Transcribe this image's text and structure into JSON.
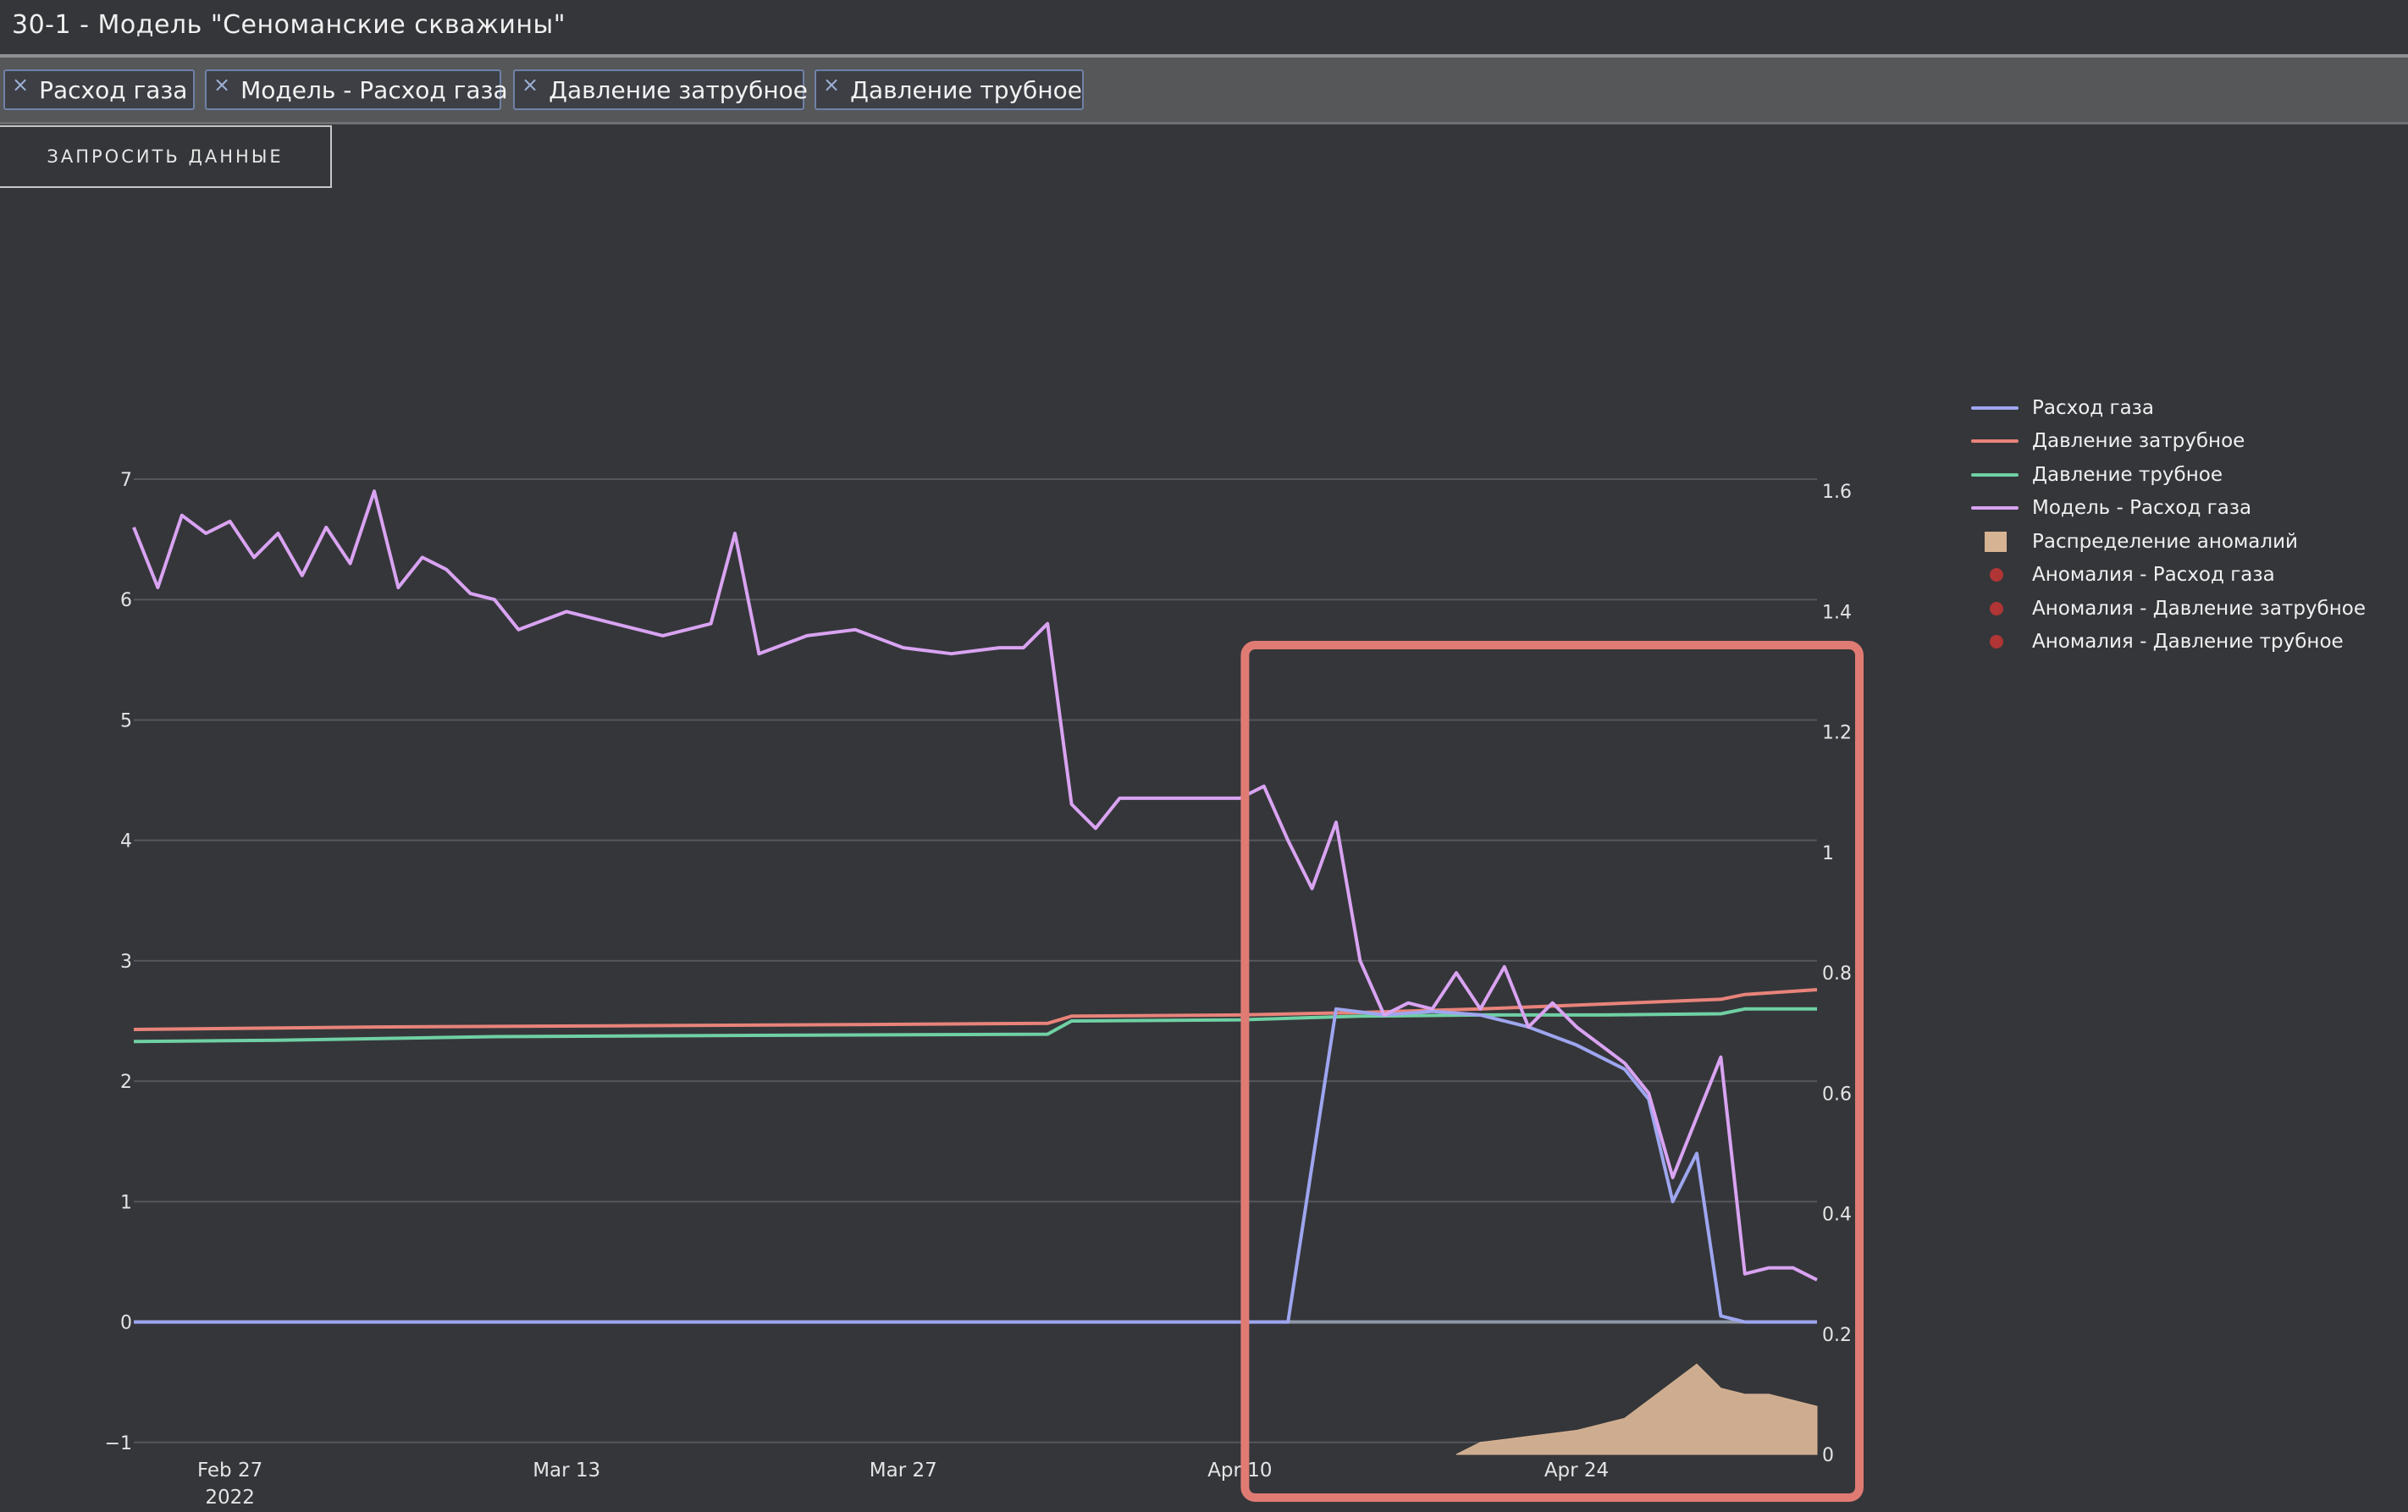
{
  "window": {
    "title": "30-1 - Модель \"Сеноманские скважины\""
  },
  "tags": [
    {
      "label": "Расход газа",
      "remove": "×"
    },
    {
      "label": "Модель - Расход газа",
      "remove": "×"
    },
    {
      "label": "Давление затрубное",
      "remove": "×"
    },
    {
      "label": "Давление трубное",
      "remove": "×"
    }
  ],
  "toolbar": {
    "request_button": "ЗАПРОСИТЬ ДАННЫЕ"
  },
  "legend": [
    {
      "label": "Расход газа",
      "color": "#9ea6f0",
      "kind": "line"
    },
    {
      "label": "Давление затрубное",
      "color": "#e8837a",
      "kind": "line"
    },
    {
      "label": "Давление трубное",
      "color": "#6fd0a4",
      "kind": "line"
    },
    {
      "label": "Модель - Расход газа",
      "color": "#d9a3f2",
      "kind": "line"
    },
    {
      "label": "Распределение аномалий",
      "color": "#d6b393",
      "kind": "box"
    },
    {
      "label": "Аномалия - Расход газа",
      "color": "#b03535",
      "kind": "dot"
    },
    {
      "label": "Аномалия - Давление затрубное",
      "color": "#b03535",
      "kind": "dot"
    },
    {
      "label": "Аномалия - Давление трубное",
      "color": "#b03535",
      "kind": "dot"
    }
  ],
  "chart_data": {
    "type": "line",
    "title": "",
    "xlabel": "",
    "ylabel": "",
    "x_range": [
      "2022-02-23",
      "2022-05-04"
    ],
    "ylim": [
      -1.1,
      7
    ],
    "y2lim": [
      0,
      1.6
    ],
    "y_ticks": [
      "7",
      "6",
      "5",
      "4",
      "3",
      "2",
      "1",
      "0",
      "−1"
    ],
    "y2_ticks": [
      "1.6",
      "1.4",
      "1.2",
      "1",
      "0.8",
      "0.6",
      "0.4",
      "0.2",
      "0"
    ],
    "x_ticks": [
      {
        "date": "2022-02-27",
        "label": "Feb 27",
        "sublabel": "2022"
      },
      {
        "date": "2022-03-13",
        "label": "Mar 13",
        "sublabel": ""
      },
      {
        "date": "2022-03-27",
        "label": "Mar 27",
        "sublabel": ""
      },
      {
        "date": "2022-04-10",
        "label": "Apr 10",
        "sublabel": ""
      },
      {
        "date": "2022-04-24",
        "label": "Apr 24",
        "sublabel": ""
      }
    ],
    "grid": true,
    "legend_position": "right",
    "highlight": {
      "x_start": "2022-04-10",
      "x_end": "2022-05-04",
      "color": "#e07b74"
    },
    "series": [
      {
        "name": "Давление затрубное",
        "axis": "left",
        "color": "#e8837a",
        "x": [
          "2022-02-23",
          "2022-03-05",
          "2022-03-15",
          "2022-03-25",
          "2022-04-02",
          "2022-04-03",
          "2022-04-10",
          "2022-04-15",
          "2022-04-20",
          "2022-04-25",
          "2022-04-30",
          "2022-05-01",
          "2022-05-04"
        ],
        "y": [
          2.43,
          2.45,
          2.46,
          2.47,
          2.48,
          2.54,
          2.55,
          2.57,
          2.6,
          2.64,
          2.68,
          2.72,
          2.76
        ]
      },
      {
        "name": "Давление трубное",
        "axis": "left",
        "color": "#6fd0a4",
        "x": [
          "2022-02-23",
          "2022-03-01",
          "2022-03-10",
          "2022-03-20",
          "2022-04-02",
          "2022-04-03",
          "2022-04-10",
          "2022-04-15",
          "2022-04-20",
          "2022-04-25",
          "2022-04-30",
          "2022-05-01",
          "2022-05-04"
        ],
        "y": [
          2.33,
          2.34,
          2.37,
          2.38,
          2.39,
          2.5,
          2.51,
          2.54,
          2.55,
          2.55,
          2.56,
          2.6,
          2.6
        ]
      },
      {
        "name": "Расход газа",
        "axis": "left",
        "color": "#9ea6f0",
        "x": [
          "2022-02-23",
          "2022-04-12",
          "2022-04-14",
          "2022-04-16",
          "2022-04-18",
          "2022-04-20",
          "2022-04-22",
          "2022-04-24",
          "2022-04-26",
          "2022-04-27",
          "2022-04-28",
          "2022-04-29",
          "2022-04-30",
          "2022-05-01",
          "2022-05-04"
        ],
        "y": [
          0,
          0,
          2.6,
          2.55,
          2.58,
          2.55,
          2.45,
          2.3,
          2.1,
          1.85,
          1.0,
          1.4,
          0.05,
          0,
          0
        ]
      },
      {
        "name": "Модель - Расход газа",
        "axis": "left",
        "color": "#d9a3f2",
        "x": [
          "2022-02-23",
          "2022-02-24",
          "2022-02-25",
          "2022-02-26",
          "2022-02-27",
          "2022-02-28",
          "2022-03-01",
          "2022-03-02",
          "2022-03-03",
          "2022-03-04",
          "2022-03-05",
          "2022-03-06",
          "2022-03-07",
          "2022-03-08",
          "2022-03-09",
          "2022-03-10",
          "2022-03-11",
          "2022-03-13",
          "2022-03-15",
          "2022-03-17",
          "2022-03-19",
          "2022-03-20",
          "2022-03-21",
          "2022-03-23",
          "2022-03-25",
          "2022-03-27",
          "2022-03-29",
          "2022-03-31",
          "2022-04-01",
          "2022-04-02",
          "2022-04-03",
          "2022-04-04",
          "2022-04-05",
          "2022-04-07",
          "2022-04-09",
          "2022-04-10",
          "2022-04-11",
          "2022-04-12",
          "2022-04-13",
          "2022-04-14",
          "2022-04-15",
          "2022-04-16",
          "2022-04-17",
          "2022-04-18",
          "2022-04-19",
          "2022-04-20",
          "2022-04-21",
          "2022-04-22",
          "2022-04-23",
          "2022-04-24",
          "2022-04-25",
          "2022-04-26",
          "2022-04-27",
          "2022-04-28",
          "2022-04-29",
          "2022-04-30",
          "2022-05-01",
          "2022-05-02",
          "2022-05-03",
          "2022-05-04"
        ],
        "y": [
          6.6,
          6.1,
          6.7,
          6.55,
          6.65,
          6.35,
          6.55,
          6.2,
          6.6,
          6.3,
          6.9,
          6.1,
          6.35,
          6.25,
          6.05,
          6.0,
          5.75,
          5.9,
          5.8,
          5.7,
          5.8,
          6.55,
          5.55,
          5.7,
          5.75,
          5.6,
          5.55,
          5.6,
          5.6,
          5.8,
          4.3,
          4.1,
          4.35,
          4.35,
          4.35,
          4.35,
          4.45,
          4.0,
          3.6,
          4.15,
          3.0,
          2.55,
          2.65,
          2.6,
          2.9,
          2.6,
          2.95,
          2.45,
          2.65,
          2.45,
          2.3,
          2.15,
          1.9,
          1.2,
          1.7,
          2.2,
          0.4,
          0.45,
          0.45,
          0.35
        ]
      },
      {
        "name": "Распределение аномалий",
        "axis": "right",
        "type": "area",
        "color": "#d6b393",
        "x": [
          "2022-04-19",
          "2022-04-20",
          "2022-04-21",
          "2022-04-22",
          "2022-04-23",
          "2022-04-24",
          "2022-04-25",
          "2022-04-26",
          "2022-04-27",
          "2022-04-28",
          "2022-04-29",
          "2022-04-30",
          "2022-05-01",
          "2022-05-02",
          "2022-05-03",
          "2022-05-04"
        ],
        "y": [
          0,
          0.02,
          0.025,
          0.03,
          0.035,
          0.04,
          0.05,
          0.06,
          0.09,
          0.12,
          0.15,
          0.11,
          0.1,
          0.1,
          0.09,
          0.08
        ]
      }
    ]
  }
}
